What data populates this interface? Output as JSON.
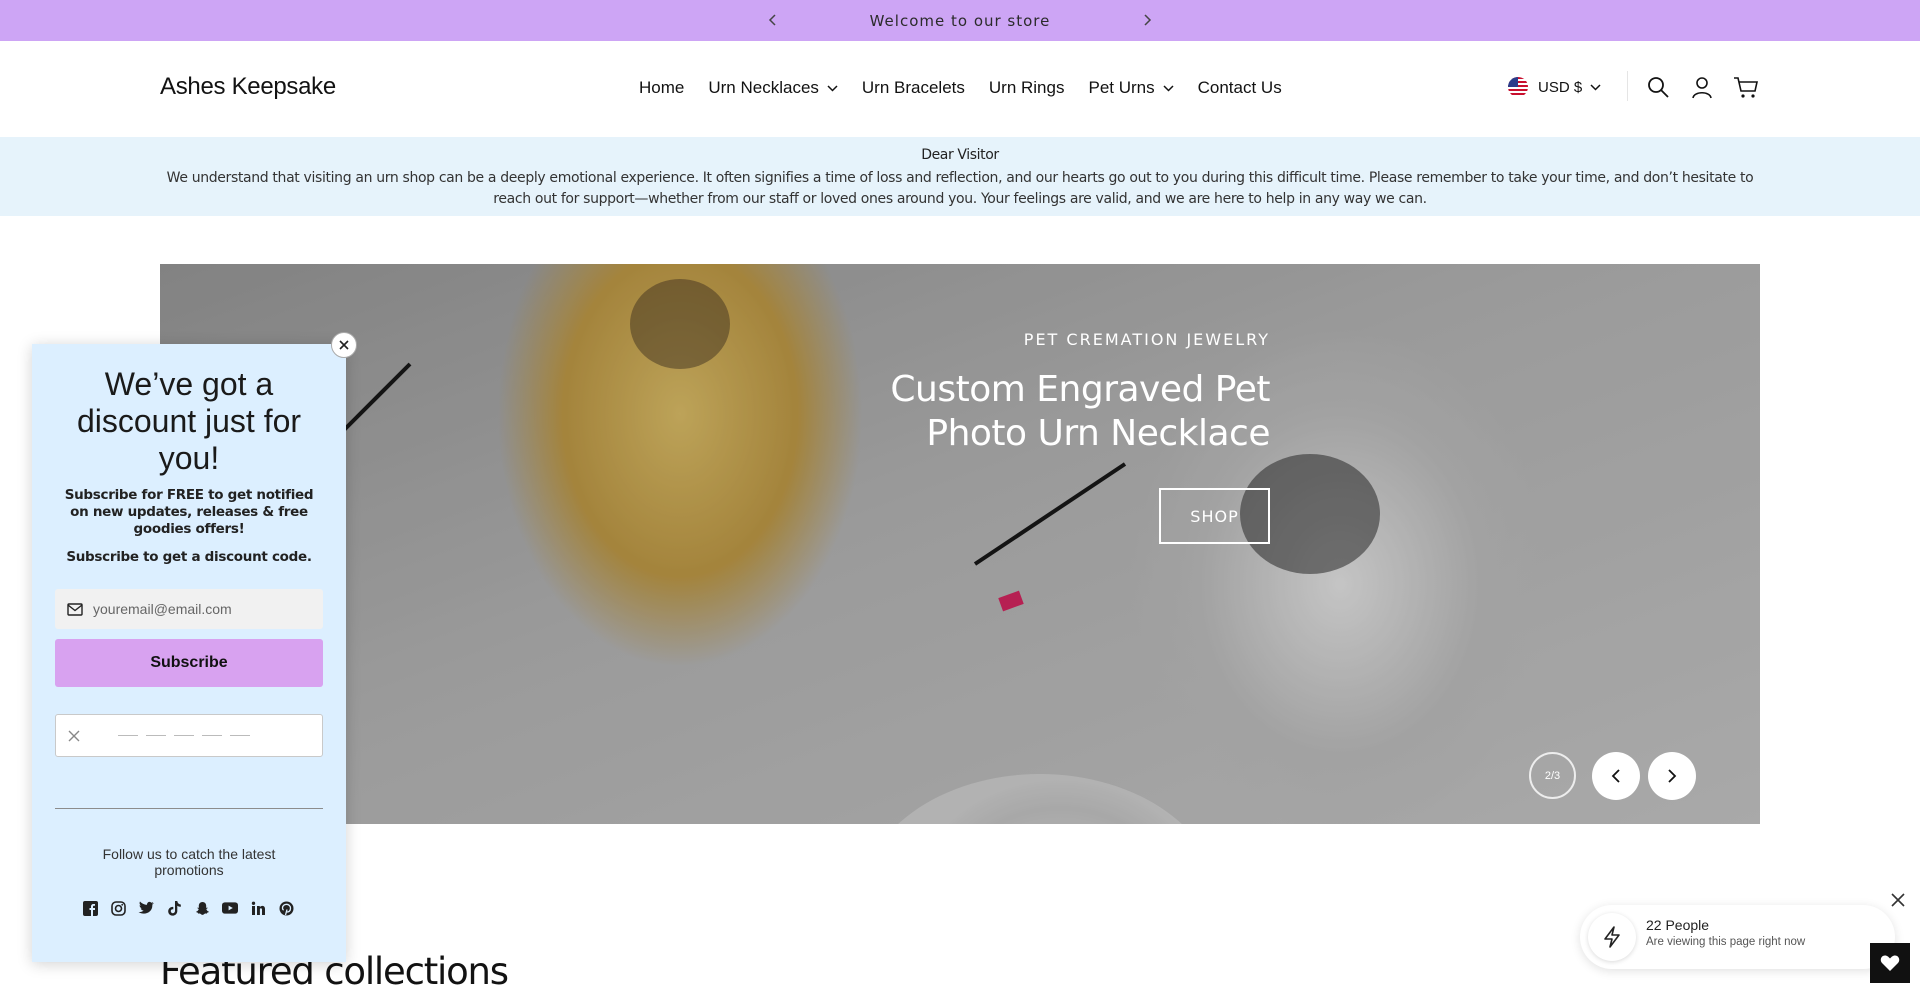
{
  "announcement": {
    "text": "Welcome to our store",
    "prev_icon": "chevron-left-icon",
    "next_icon": "chevron-right-icon",
    "bg_color": "#cda5f5"
  },
  "header": {
    "logo": "Ashes Keepsake",
    "nav": [
      {
        "label": "Home",
        "has_dropdown": false
      },
      {
        "label": "Urn Necklaces",
        "has_dropdown": true
      },
      {
        "label": "Urn Bracelets",
        "has_dropdown": false
      },
      {
        "label": "Urn Rings",
        "has_dropdown": false
      },
      {
        "label": "Pet Urns",
        "has_dropdown": true
      },
      {
        "label": "Contact Us",
        "has_dropdown": false
      }
    ],
    "currency": "USD $",
    "icons": [
      "search-icon",
      "account-icon",
      "cart-icon"
    ]
  },
  "notice": {
    "title": "Dear Visitor",
    "body": "We understand that visiting an urn shop can be a deeply emotional experience. It often signifies a time of loss and reflection, and our hearts go out to you during this difficult time. Please remember to take your time, and don’t hesitate to reach out for support—whether from our staff or loved ones around you. Your feelings are valid, and we are here to help in any way we can.",
    "bg_color": "#e6f3fb"
  },
  "hero": {
    "subtitle": "PET CREMATION JEWELRY",
    "headline": "Custom Engraved Pet Photo Urn Necklace",
    "button": "SHOP",
    "slide_counter": "2/3"
  },
  "featured": {
    "title": "Featured collections"
  },
  "popup": {
    "heading": "We’ve got a discount just for you!",
    "description": "Subscribe for FREE to get notified on new updates, releases & free goodies offers!",
    "description2": "Subscribe to get a discount code.",
    "email_placeholder": "youremail@email.com",
    "subscribe_label": "Subscribe",
    "follow_text": "Follow us to catch the latest promotions",
    "socials": [
      "facebook-icon",
      "instagram-icon",
      "twitter-icon",
      "tiktok-icon",
      "snapchat-icon",
      "youtube-icon",
      "linkedin-icon",
      "pinterest-icon"
    ],
    "bg_color": "#dcefff",
    "button_color": "#d8a2f0"
  },
  "viewers": {
    "count": "22 People",
    "subtitle": "Are viewing this page right now"
  }
}
